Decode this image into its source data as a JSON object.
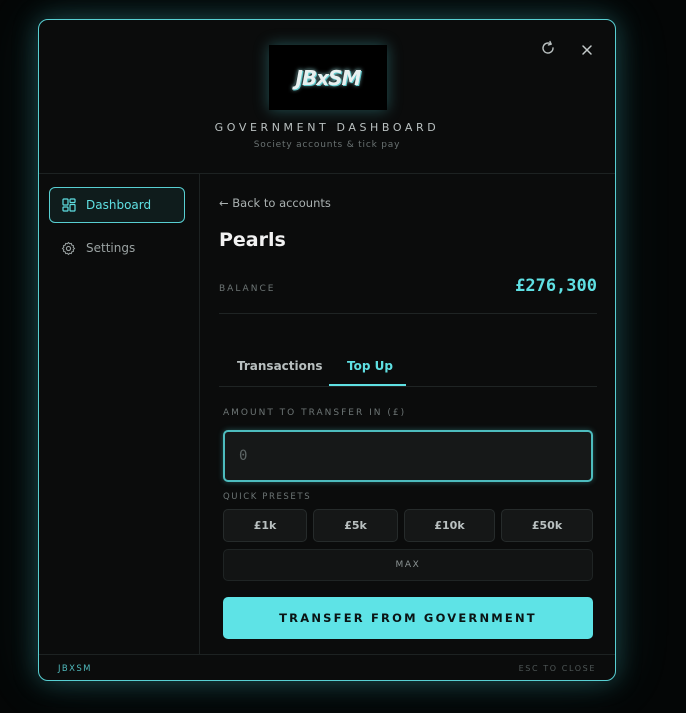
{
  "header": {
    "logo_text": "JBxSM",
    "title": "GOVERNMENT DASHBOARD",
    "subtitle": "Society accounts & tick pay",
    "refresh_icon": "refresh-icon",
    "close_icon": "close-icon"
  },
  "sidebar": {
    "items": [
      {
        "label": "Dashboard",
        "icon": "grid-icon",
        "active": true
      },
      {
        "label": "Settings",
        "icon": "gear-icon",
        "active": false
      }
    ]
  },
  "main": {
    "back_link": "← Back to accounts",
    "account_name": "Pearls",
    "balance_label": "BALANCE",
    "balance_value": "£276,300",
    "tabs": [
      {
        "label": "Transactions",
        "active": false
      },
      {
        "label": "Top Up",
        "active": true
      }
    ],
    "amount_label": "AMOUNT TO TRANSFER IN (£)",
    "amount_placeholder": "0",
    "amount_value": "",
    "presets_label": "QUICK PRESETS",
    "presets": [
      "£1k",
      "£5k",
      "£10k",
      "£50k"
    ],
    "max_label": "MAX",
    "transfer_label": "TRANSFER FROM GOVERNMENT"
  },
  "footer": {
    "left": "JBXSM",
    "right": "ESC TO CLOSE"
  },
  "colors": {
    "accent": "#5fe0e3",
    "border": "#58cfd2",
    "background": "#0b0c0c"
  }
}
